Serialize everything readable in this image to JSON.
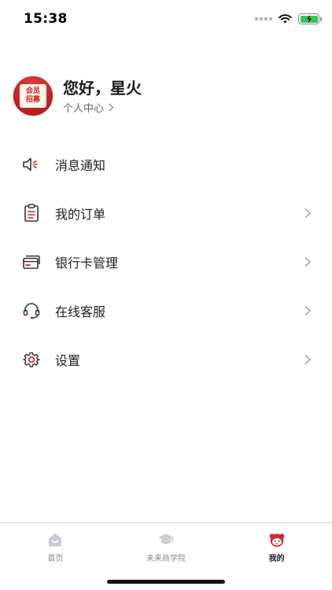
{
  "status_bar": {
    "time": "15:38"
  },
  "profile": {
    "greeting": "您好，星火",
    "personal_center": "个人中心",
    "avatar_text_line1": "会员",
    "avatar_text_line2": "招募"
  },
  "menu": {
    "items": [
      {
        "label": "消息通知",
        "icon": "speaker-icon",
        "has_chevron": false
      },
      {
        "label": "我的订单",
        "icon": "clipboard-icon",
        "has_chevron": true
      },
      {
        "label": "银行卡管理",
        "icon": "bank-card-icon",
        "has_chevron": true
      },
      {
        "label": "在线客服",
        "icon": "headset-icon",
        "has_chevron": true
      },
      {
        "label": "设置",
        "icon": "gear-icon",
        "has_chevron": true
      }
    ]
  },
  "tab_bar": {
    "tabs": [
      {
        "label": "首页",
        "icon": "home-icon",
        "active": false
      },
      {
        "label": "未来商学院",
        "icon": "graduation-cap-icon",
        "active": false
      },
      {
        "label": "我的",
        "icon": "mascot-icon",
        "active": true
      }
    ]
  },
  "colors": {
    "accent": "#c62a2a",
    "icon_red": "#c62a2a",
    "text": "#1f1f1f",
    "muted": "#8a8a8a"
  }
}
